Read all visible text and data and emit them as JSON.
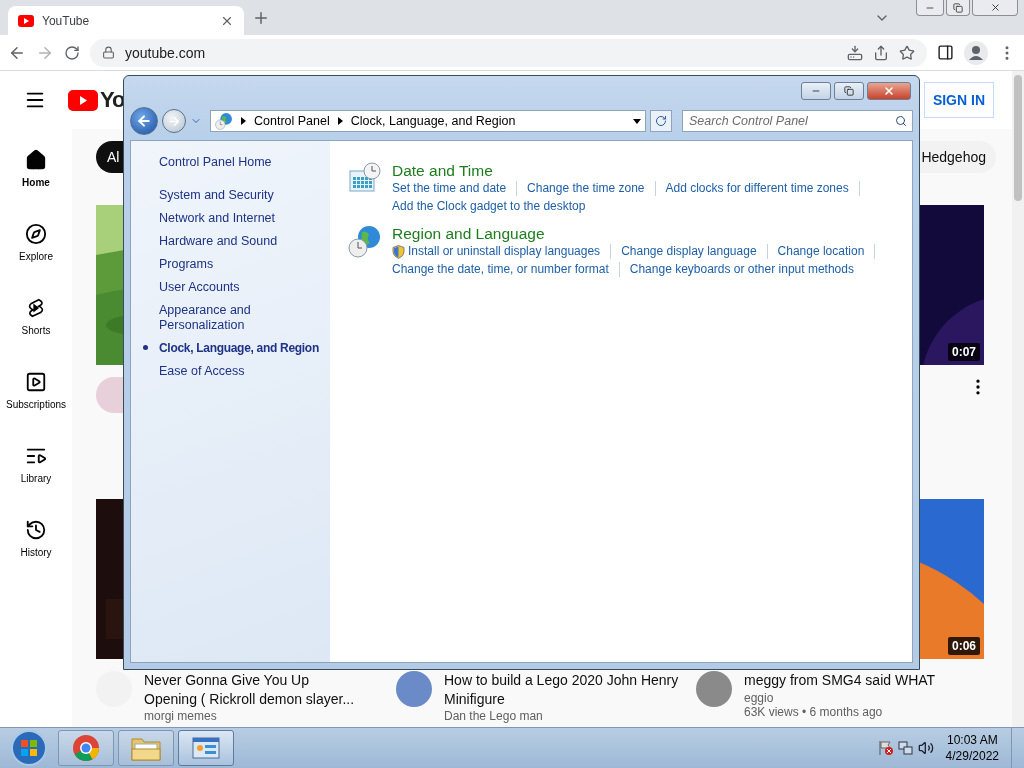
{
  "browser": {
    "tab": {
      "title": "YouTube"
    },
    "address": "youtube.com"
  },
  "youtube": {
    "logo_text": "Yo",
    "sign_in": "SIGN IN",
    "sidebar": [
      {
        "label": "Home",
        "selected": true
      },
      {
        "label": "Explore",
        "selected": false
      },
      {
        "label": "Shorts",
        "selected": false
      },
      {
        "label": "Subscriptions",
        "selected": false
      },
      {
        "label": "Library",
        "selected": false
      },
      {
        "label": "History",
        "selected": false
      }
    ],
    "chips": [
      {
        "label": "Al",
        "selected": true
      },
      {
        "label": "Hedgehog",
        "selected": false
      }
    ],
    "row_1": [
      {
        "kind": "avatar"
      },
      {
        "kind": "menu",
        "duration": "0:07"
      }
    ],
    "row_2": [
      {
        "title": "Never Gonna Give You Up Opening ( Rickroll demon slayer...",
        "channel": "morgi memes"
      },
      {
        "title": "How to build a Lego 2020 John Henry Minifigure",
        "channel": "Dan the Lego man"
      },
      {
        "title": "meggy from SMG4 said WHAT",
        "channel": "eggio",
        "meta": "63K views • 6 months ago",
        "duration": "0:06"
      }
    ]
  },
  "control_panel": {
    "breadcrumb": [
      "Control Panel",
      "Clock, Language, and Region"
    ],
    "search": {
      "placeholder": "Search Control Panel"
    },
    "home": "Control Panel Home",
    "nav": [
      {
        "label": "System and Security",
        "selected": false
      },
      {
        "label": "Network and Internet",
        "selected": false
      },
      {
        "label": "Hardware and Sound",
        "selected": false
      },
      {
        "label": "Programs",
        "selected": false
      },
      {
        "label": "User Accounts",
        "selected": false
      },
      {
        "label": "Appearance and Personalization",
        "selected": false
      },
      {
        "label": "Clock, Language, and Region",
        "selected": true
      },
      {
        "label": "Ease of Access",
        "selected": false
      }
    ],
    "sections": [
      {
        "kind": "clock",
        "title": "Date and Time",
        "links": [
          {
            "label": "Set the time and date",
            "shield": false
          },
          {
            "label": "Change the time zone",
            "shield": false
          },
          {
            "label": "Add clocks for different time zones",
            "shield": false
          },
          {
            "label": "Add the Clock gadget to the desktop",
            "shield": false
          }
        ]
      },
      {
        "kind": "globe",
        "title": "Region and Language",
        "links": [
          {
            "label": "Install or uninstall display languages",
            "shield": true
          },
          {
            "label": "Change display language",
            "shield": false
          },
          {
            "label": "Change location",
            "shield": false
          },
          {
            "label": "Change the date, time, or number format",
            "shield": false
          },
          {
            "label": "Change keyboards or other input methods",
            "shield": false
          }
        ]
      }
    ]
  },
  "taskbar": {
    "apps": [
      {
        "kind": "chrome",
        "selected": false
      },
      {
        "kind": "folder",
        "selected": false
      },
      {
        "kind": "control-panel",
        "selected": true
      }
    ],
    "time": "10:03 AM",
    "date": "4/29/2022"
  }
}
